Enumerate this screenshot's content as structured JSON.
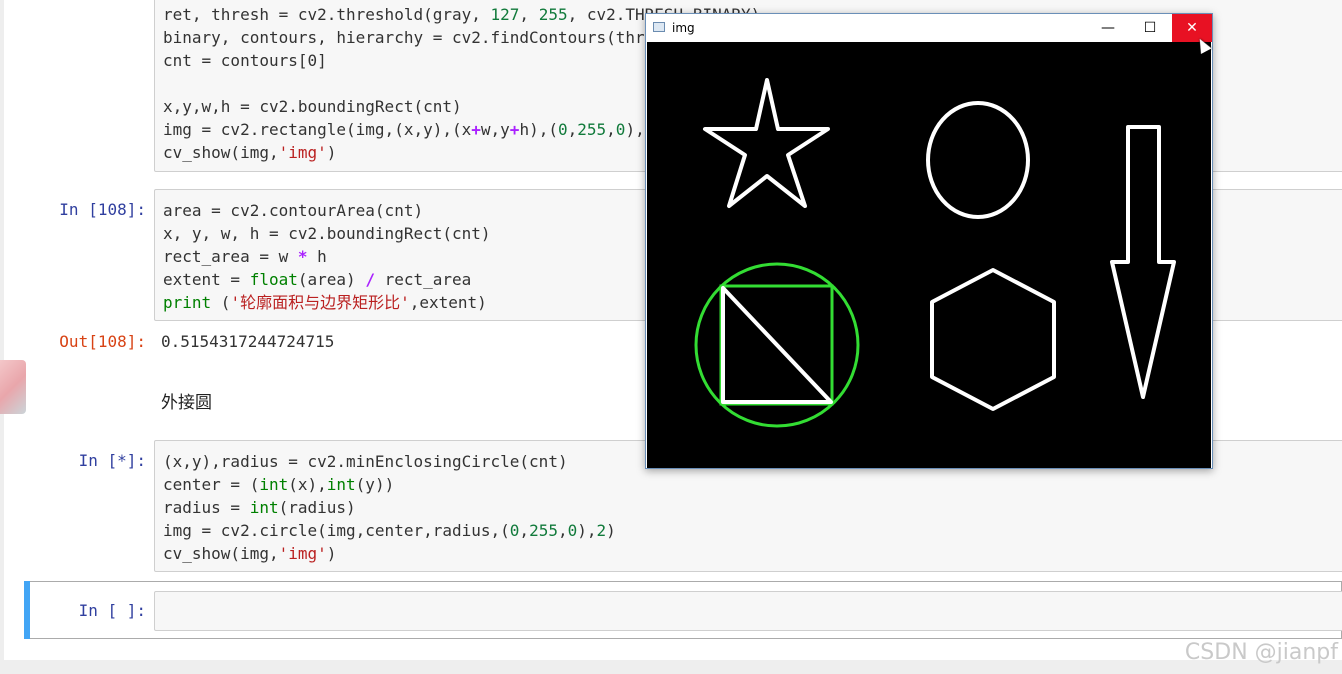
{
  "cell1": {
    "lines": [
      "ret, thresh = cv2.threshold(gray, 127, 255, cv2.THRESH_BINARY)",
      "binary, contours, hierarchy = cv2.findContours(thr",
      "cnt = contours[0]",
      "",
      "x,y,w,h = cv2.boundingRect(cnt)",
      "img = cv2.rectangle(img,(x,y),(x+w,y+h),(0,255,0),",
      "cv_show(img,'img')"
    ]
  },
  "cell2": {
    "prompt": "In [108]:",
    "lines": [
      "area = cv2.contourArea(cnt)",
      "x, y, w, h = cv2.boundingRect(cnt)",
      "rect_area = w * h",
      "extent = float(area) / rect_area",
      "print ('轮廓面积与边界矩形比',extent)"
    ],
    "out_prompt": "Out[108]:",
    "output": "0.5154317244724715"
  },
  "markdown": {
    "text": "外接圆"
  },
  "cell3": {
    "prompt": "In [*]:",
    "lines": [
      "(x,y),radius = cv2.minEnclosingCircle(cnt)",
      "center = (int(x),int(y))",
      "radius = int(radius)",
      "img = cv2.circle(img,center,radius,(0,255,0),2)",
      "cv_show(img,'img')"
    ]
  },
  "cell4": {
    "prompt": "In [ ]:"
  },
  "window": {
    "title": "img",
    "min_label": "—",
    "max_label": "☐",
    "close_label": "✕"
  },
  "watermark": "CSDN @jianpf",
  "colors": {
    "accent": "#42a5f5",
    "close_red": "#e81123",
    "contour_green": "#33dd33",
    "shape_white": "#ffffff"
  }
}
